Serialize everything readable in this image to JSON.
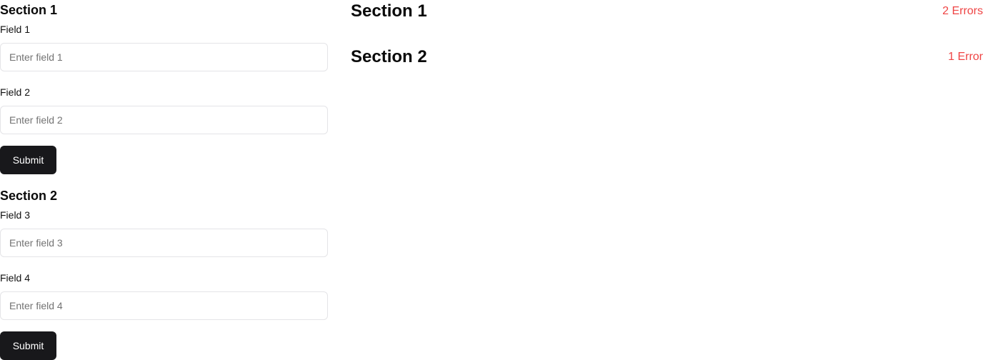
{
  "form": {
    "sections": [
      {
        "heading": "Section 1",
        "fields": [
          {
            "label": "Field 1",
            "placeholder": "Enter field 1",
            "value": ""
          },
          {
            "label": "Field 2",
            "placeholder": "Enter field 2",
            "value": ""
          }
        ],
        "submit_label": "Submit"
      },
      {
        "heading": "Section 2",
        "fields": [
          {
            "label": "Field 3",
            "placeholder": "Enter field 3",
            "value": ""
          },
          {
            "label": "Field 4",
            "placeholder": "Enter field 4",
            "value": ""
          }
        ],
        "submit_label": "Submit"
      }
    ]
  },
  "summary": {
    "rows": [
      {
        "title": "Section 1",
        "errors": "2 Errors"
      },
      {
        "title": "Section 2",
        "errors": "1 Error"
      }
    ]
  },
  "colors": {
    "error_text": "#ef4444",
    "button_background": "#18181b",
    "button_text": "#ffffff",
    "input_border": "#e4e4e7"
  }
}
